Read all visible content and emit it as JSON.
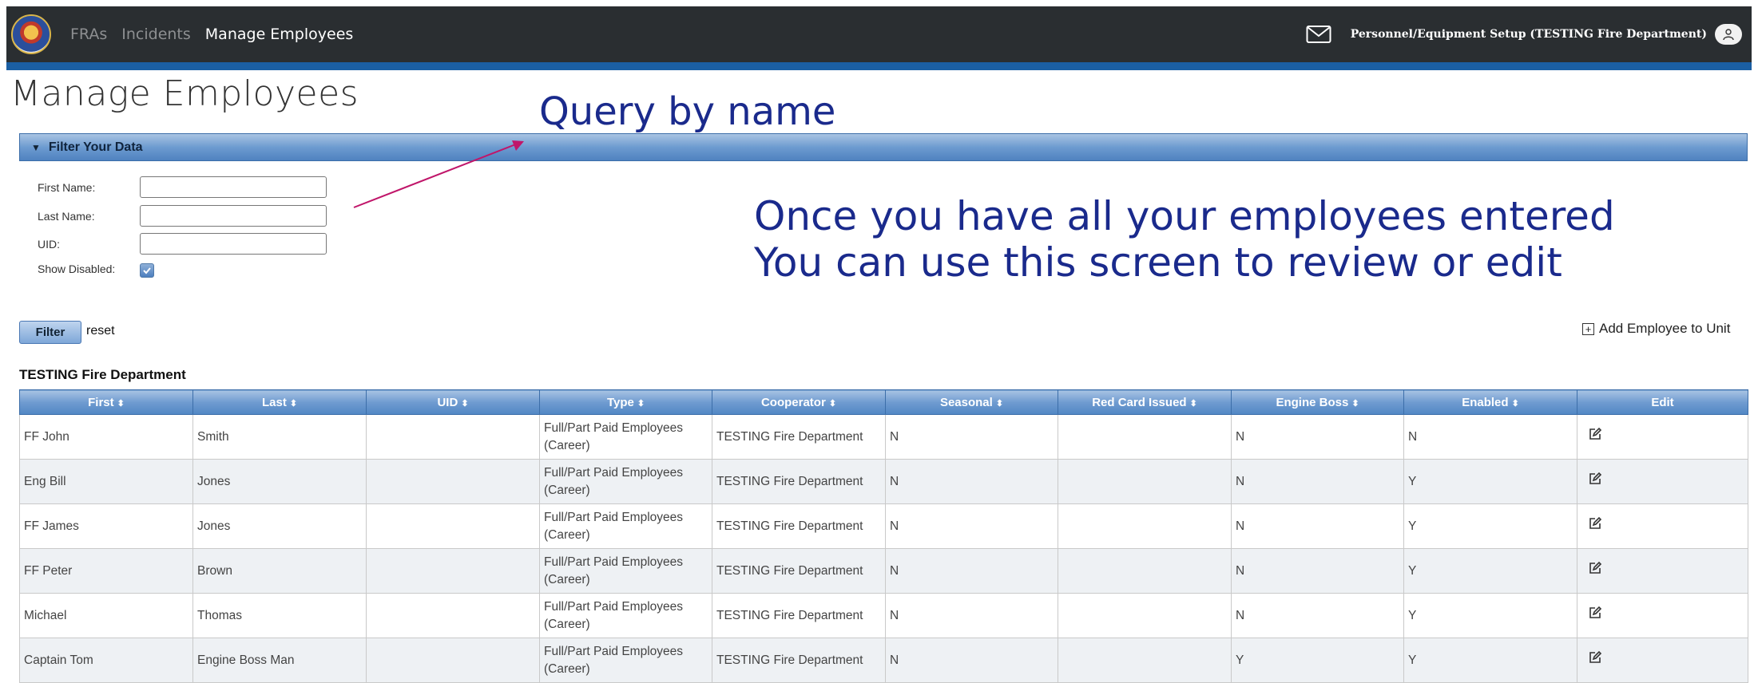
{
  "nav": {
    "links": [
      "FRAs",
      "Incidents",
      "Manage Employees"
    ],
    "setup_label": "Personnel/Equipment Setup (TESTING Fire Department)"
  },
  "page": {
    "title": "Manage Employees"
  },
  "annotations": {
    "query": "Query by name",
    "note_line1": "Once you have all your employees entered",
    "note_line2": "You can use this screen to review or edit",
    "color": "#1a2a8c",
    "arrow_color": "#c0166a"
  },
  "filter": {
    "title": "Filter Your Data",
    "first_name_label": "First Name:",
    "last_name_label": "Last Name:",
    "uid_label": "UID:",
    "show_disabled_label": "Show Disabled:",
    "show_disabled": true,
    "first_name_value": "",
    "last_name_value": "",
    "uid_value": "",
    "filter_button": "Filter",
    "reset_link": "reset"
  },
  "add_employee": "Add Employee to Unit",
  "department": "TESTING Fire Department",
  "table": {
    "columns": [
      "First",
      "Last",
      "UID",
      "Type",
      "Cooperator",
      "Seasonal",
      "Red Card Issued",
      "Engine Boss",
      "Enabled",
      "Edit"
    ],
    "rows": [
      {
        "first": "FF John",
        "last": "Smith",
        "uid": "",
        "type": "Full/Part Paid Employees (Career)",
        "cooperator": "TESTING Fire Department",
        "seasonal": "N",
        "red_card": "",
        "engine_boss": "N",
        "enabled": "N"
      },
      {
        "first": "Eng Bill",
        "last": "Jones",
        "uid": "",
        "type": "Full/Part Paid Employees (Career)",
        "cooperator": "TESTING Fire Department",
        "seasonal": "N",
        "red_card": "",
        "engine_boss": "N",
        "enabled": "Y"
      },
      {
        "first": "FF James",
        "last": "Jones",
        "uid": "",
        "type": "Full/Part Paid Employees (Career)",
        "cooperator": "TESTING Fire Department",
        "seasonal": "N",
        "red_card": "",
        "engine_boss": "N",
        "enabled": "Y"
      },
      {
        "first": "FF Peter",
        "last": "Brown",
        "uid": "",
        "type": "Full/Part Paid Employees (Career)",
        "cooperator": "TESTING Fire Department",
        "seasonal": "N",
        "red_card": "",
        "engine_boss": "N",
        "enabled": "Y"
      },
      {
        "first": "Michael",
        "last": "Thomas",
        "uid": "",
        "type": "Full/Part Paid Employees (Career)",
        "cooperator": "TESTING Fire Department",
        "seasonal": "N",
        "red_card": "",
        "engine_boss": "N",
        "enabled": "Y"
      },
      {
        "first": "Captain Tom",
        "last": "Engine Boss Man",
        "uid": "",
        "type": "Full/Part Paid Employees (Career)",
        "cooperator": "TESTING Fire Department",
        "seasonal": "N",
        "red_card": "",
        "engine_boss": "Y",
        "enabled": "Y"
      }
    ]
  }
}
